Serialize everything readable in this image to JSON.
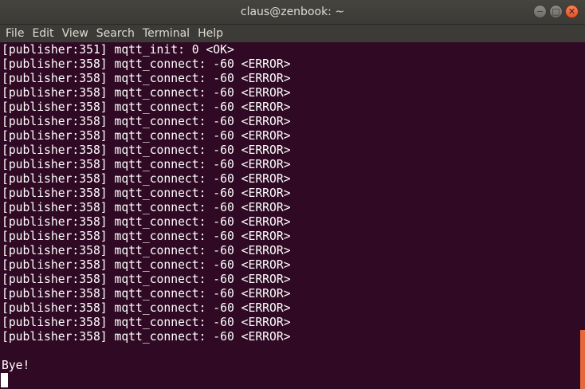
{
  "window": {
    "title": "claus@zenbook: ~",
    "controls": {
      "minimize_glyph": "−",
      "maximize_glyph": "□",
      "close_glyph": "✕"
    }
  },
  "menubar": {
    "items": [
      "File",
      "Edit",
      "View",
      "Search",
      "Terminal",
      "Help"
    ]
  },
  "terminal": {
    "lines": [
      "[publisher:351] mqtt_init: 0 <OK>",
      "[publisher:358] mqtt_connect: -60 <ERROR>",
      "[publisher:358] mqtt_connect: -60 <ERROR>",
      "[publisher:358] mqtt_connect: -60 <ERROR>",
      "[publisher:358] mqtt_connect: -60 <ERROR>",
      "[publisher:358] mqtt_connect: -60 <ERROR>",
      "[publisher:358] mqtt_connect: -60 <ERROR>",
      "[publisher:358] mqtt_connect: -60 <ERROR>",
      "[publisher:358] mqtt_connect: -60 <ERROR>",
      "[publisher:358] mqtt_connect: -60 <ERROR>",
      "[publisher:358] mqtt_connect: -60 <ERROR>",
      "[publisher:358] mqtt_connect: -60 <ERROR>",
      "[publisher:358] mqtt_connect: -60 <ERROR>",
      "[publisher:358] mqtt_connect: -60 <ERROR>",
      "[publisher:358] mqtt_connect: -60 <ERROR>",
      "[publisher:358] mqtt_connect: -60 <ERROR>",
      "[publisher:358] mqtt_connect: -60 <ERROR>",
      "[publisher:358] mqtt_connect: -60 <ERROR>",
      "[publisher:358] mqtt_connect: -60 <ERROR>",
      "[publisher:358] mqtt_connect: -60 <ERROR>",
      "[publisher:358] mqtt_connect: -60 <ERROR>",
      "",
      "Bye!"
    ]
  },
  "colors": {
    "terminal_background": "#300a24",
    "terminal_foreground": "#ffffff",
    "scrollbar_accent": "#e8683d",
    "close_button": "#e0522a"
  }
}
